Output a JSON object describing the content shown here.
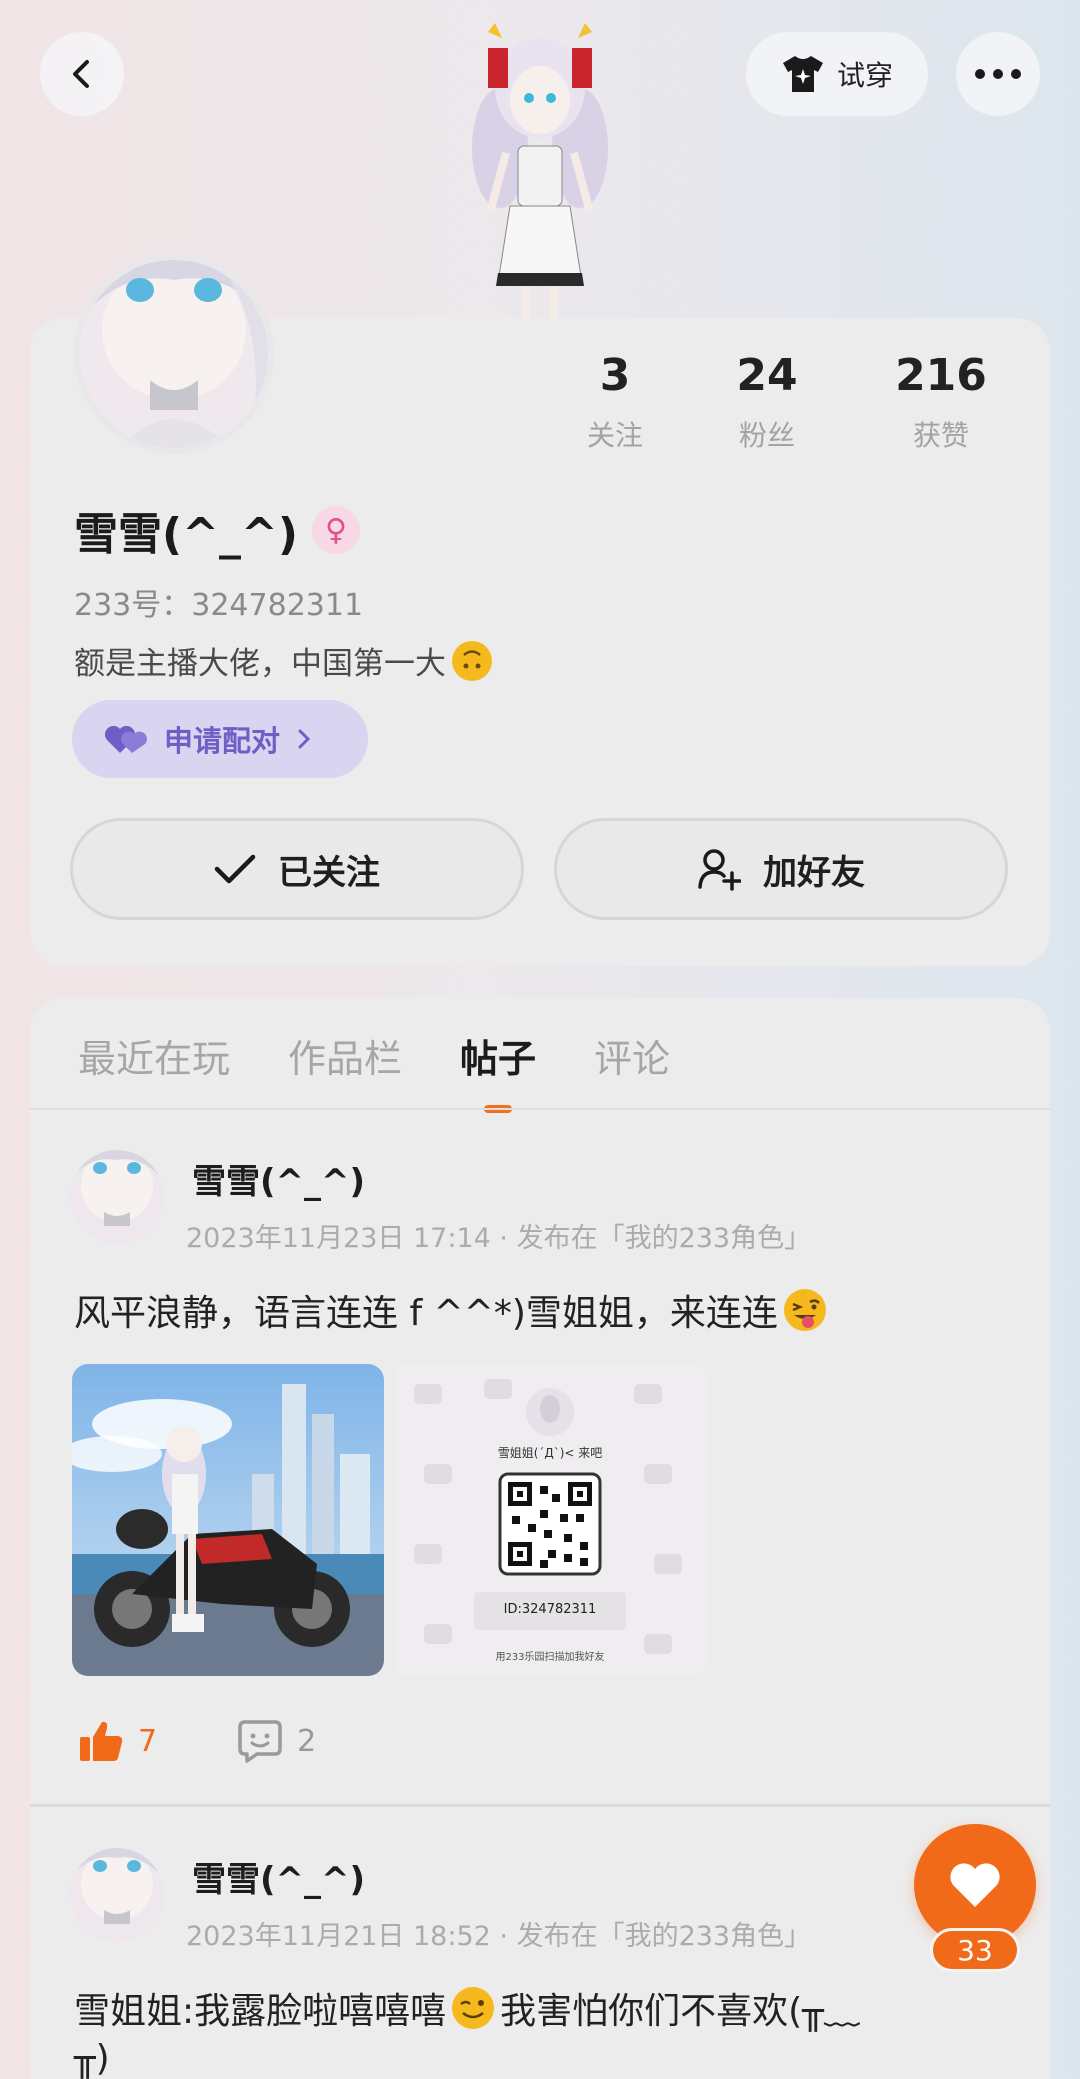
{
  "header": {
    "back_icon": "chevron-left-icon",
    "tryon_label": "试穿",
    "tryon_icon": "tshirt-icon",
    "more_icon": "more-dots-icon"
  },
  "profile": {
    "stats": [
      {
        "value": "3",
        "label": "关注"
      },
      {
        "value": "24",
        "label": "粉丝"
      },
      {
        "value": "216",
        "label": "获赞"
      }
    ],
    "name": "雪雪(^_^)",
    "gender_symbol": "♀",
    "uid": "233号：324782311",
    "bio": "额是主播大佬，中国第一大",
    "pair_label": "申请配对",
    "follow_label": "已关注",
    "add_friend_label": "加好友"
  },
  "tabs": [
    {
      "label": "最近在玩",
      "active": false
    },
    {
      "label": "作品栏",
      "active": false
    },
    {
      "label": "帖子",
      "active": true
    },
    {
      "label": "评论",
      "active": false
    }
  ],
  "posts": [
    {
      "author": "雪雪(^_^)",
      "meta": "2023年11月23日 17:14 · 发布在「我的233角色」",
      "text": "风平浪静，语言连连 f ^^*)雪姐姐，来连连",
      "image2": {
        "caption": "雪姐姐(´Д`)< 来吧",
        "id_text": "ID:324782311",
        "footer": "用233乐园扫描加我好友"
      },
      "likes": "7",
      "comments": "2"
    },
    {
      "author": "雪雪(^_^)",
      "meta": "2023年11月21日 18:52 · 发布在「我的233角色」",
      "text": "雪姐姐:我露脸啦嘻嘻嘻",
      "text_after": "我害怕你们不喜欢(╥﹏",
      "text_line2": "╥)"
    }
  ],
  "fab": {
    "count": "33"
  },
  "colors": {
    "accent": "#f06a1a",
    "pair_bg": "#d9d5f0",
    "pair_text": "#6e5ec5",
    "gender_bg": "#f8d8e4"
  }
}
